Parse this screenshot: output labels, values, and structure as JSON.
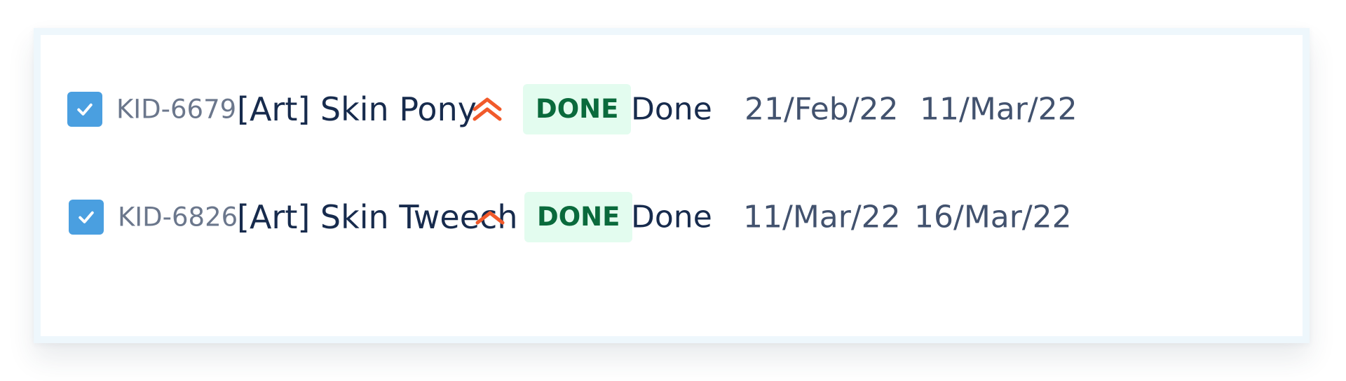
{
  "colors": {
    "checkbox": "#4a9fe0",
    "priority": "#f15a2b",
    "lozenge_bg": "#e3fcef",
    "lozenge_text": "#0a6a3c"
  },
  "rows": [
    {
      "checked": true,
      "key": "KID-6679",
      "summary": "[Art] Skin Pony",
      "priority_icon": "priority-highest-icon",
      "status": "DONE",
      "resolution": "Done",
      "created": "21/Feb/22",
      "resolved": "11/Mar/22"
    },
    {
      "checked": true,
      "key": "KID-6826",
      "summary": "[Art] Skin Tweech",
      "priority_icon": "priority-high-icon",
      "status": "DONE",
      "resolution": "Done",
      "created": "11/Mar/22",
      "resolved": "16/Mar/22"
    }
  ]
}
